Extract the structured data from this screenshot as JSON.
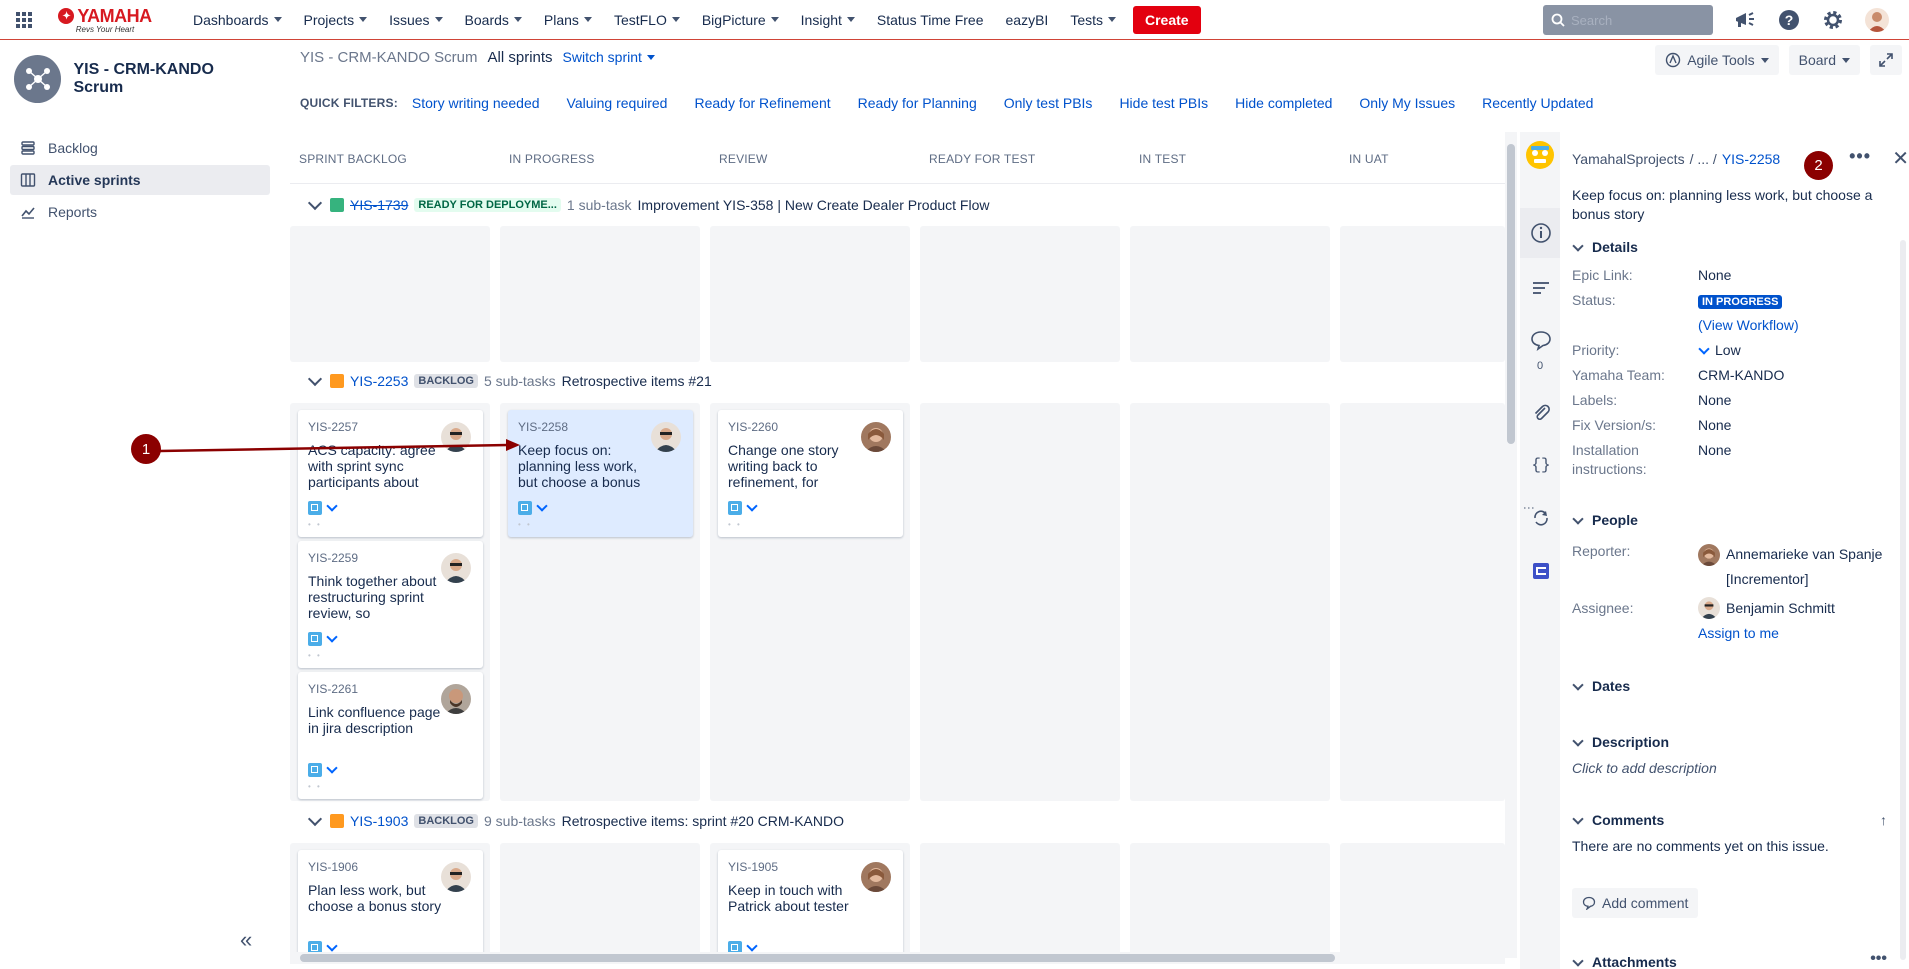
{
  "topnav": {
    "logo_text": "YAMAHA",
    "logo_tagline": "Revs Your Heart",
    "menu": [
      "Dashboards",
      "Projects",
      "Issues",
      "Boards",
      "Plans",
      "TestFLO",
      "BigPicture",
      "Insight",
      "Status Time Free",
      "eazyBI",
      "Tests"
    ],
    "menu_has_caret": [
      true,
      true,
      true,
      true,
      true,
      true,
      true,
      true,
      false,
      false,
      true
    ],
    "create_label": "Create",
    "search_placeholder": "Search"
  },
  "sidebar": {
    "project_name": "YIS - CRM-KANDO Scrum",
    "items": [
      "Backlog",
      "Active sprints",
      "Reports"
    ]
  },
  "board_header": {
    "project": "YIS - CRM-KANDO Scrum",
    "view": "All sprints",
    "switch_sprint": "Switch sprint",
    "quick_filters_label": "QUICK FILTERS:",
    "quick_filters": [
      "Story writing needed",
      "Valuing required",
      "Ready for Refinement",
      "Ready for Planning",
      "Only test PBIs",
      "Hide test PBIs",
      "Hide completed",
      "Only My Issues",
      "Recently Updated"
    ],
    "agile_tools": "Agile Tools",
    "board": "Board"
  },
  "columns": [
    "SPRINT BACKLOG",
    "IN PROGRESS",
    "REVIEW",
    "READY FOR TEST",
    "IN TEST",
    "IN UAT"
  ],
  "swimlanes": [
    {
      "key": "YIS-1739",
      "status": "READY FOR DEPLOYME...",
      "subtasks": "1 sub-task",
      "summary": "Improvement YIS-358 | New Create Dealer Product Flow"
    },
    {
      "key": "YIS-2253",
      "status": "BACKLOG",
      "subtasks": "5 sub-tasks",
      "summary": "Retrospective items #21"
    },
    {
      "key": "YIS-1903",
      "status": "BACKLOG",
      "subtasks": "9 sub-tasks",
      "summary": "Retrospective items: sprint #20 CRM-KANDO"
    }
  ],
  "cards": [
    {
      "key": "YIS-2257",
      "summary": "ACS capacity: agree with sprint sync participants about",
      "dots": "• •"
    },
    {
      "key": "YIS-2258",
      "summary": "Keep focus on: planning less work, but choose a bonus",
      "dots": "• •"
    },
    {
      "key": "YIS-2260",
      "summary": "Change one story writing back to refinement, for",
      "dots": "• •"
    },
    {
      "key": "YIS-2259",
      "summary": "Think together about restructuring sprint review, so",
      "dots": "• •"
    },
    {
      "key": "YIS-2261",
      "summary": "Link confluence page in jira description",
      "dots": "• •"
    },
    {
      "key": "YIS-1906",
      "summary": "Plan less work, but choose a bonus story",
      "dots": ""
    },
    {
      "key": "YIS-1905",
      "summary": "Keep in touch with Patrick about tester",
      "dots": "• • • • • • •"
    }
  ],
  "annotations": [
    "1",
    "2"
  ],
  "detail": {
    "crumb_project": "YamahalSprojects",
    "crumb_sep": "/ ... /",
    "crumb_key": "YIS-2258",
    "more": "•••",
    "title": "Keep focus on: planning less work, but choose a bonus story",
    "comment_count": "0",
    "sections": {
      "details": "Details",
      "people": "People",
      "dates": "Dates",
      "description": "Description",
      "comments": "Comments",
      "attachments": "Attachments"
    },
    "fields": {
      "epic_label": "Epic Link:",
      "epic_value": "None",
      "status_label": "Status:",
      "status_value": "IN PROGRESS",
      "view_workflow": "(View Workflow)",
      "priority_label": "Priority:",
      "priority_value": "Low",
      "team_label": "Yamaha Team:",
      "team_value": "CRM-KANDO",
      "labels_label": "Labels:",
      "labels_value": "None",
      "fix_label": "Fix Version/s:",
      "fix_value": "None",
      "install_label": "Installation instructions:",
      "install_value": "None"
    },
    "people": {
      "reporter_label": "Reporter:",
      "reporter_name": "Annemarieke van Spanje [Incrementor]",
      "assignee_label": "Assignee:",
      "assignee_name": "Benjamin Schmitt",
      "assign_to_me": "Assign to me"
    },
    "description_placeholder": "Click to add description",
    "no_comments": "There are no comments yet on this issue.",
    "add_comment": "Add comment"
  },
  "colors": {
    "brand_red": "#e3000f",
    "link_blue": "#0052cc",
    "annotation_red": "#8b0000",
    "column_bg": "#f4f5f7",
    "selected_card": "#deebff"
  }
}
